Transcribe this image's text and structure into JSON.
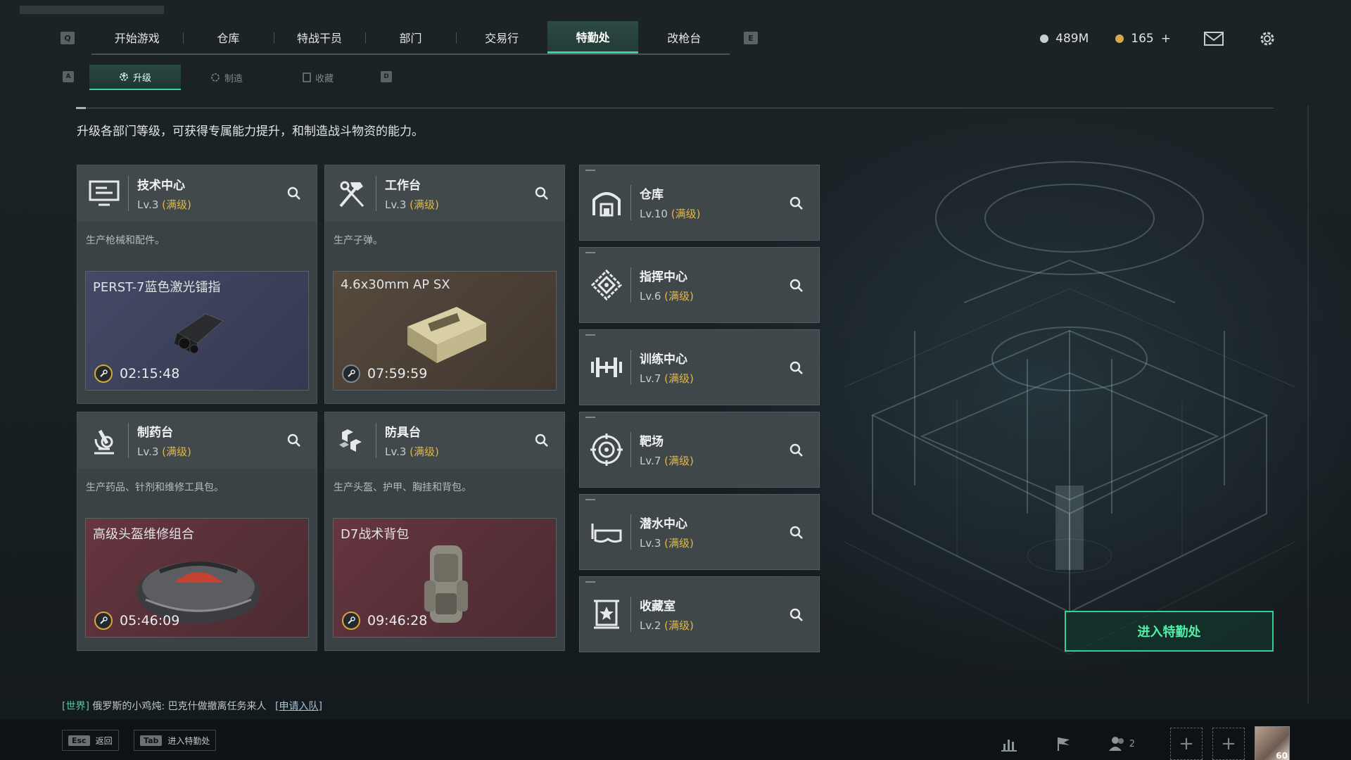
{
  "nav": {
    "left_key": "Q",
    "right_key": "E",
    "tabs": [
      {
        "label": "开始游戏"
      },
      {
        "label": "仓库"
      },
      {
        "label": "特战干员"
      },
      {
        "label": "部门"
      },
      {
        "label": "交易行"
      },
      {
        "label": "特勤处"
      },
      {
        "label": "改枪台"
      }
    ],
    "active_tab": "特勤处"
  },
  "currency": {
    "silver": "489M",
    "gold": "165",
    "gold_add": "+"
  },
  "subnav": {
    "left_key": "A",
    "right_key": "D",
    "tabs": [
      {
        "label": "升级"
      },
      {
        "label": "制造"
      },
      {
        "label": "收藏"
      }
    ],
    "active_tab": "升级"
  },
  "description": "升级各部门等级，可获得专属能力提升，和制造战斗物资的能力。",
  "production_cards": [
    {
      "name": "技术中心",
      "level": "Lv.3",
      "status": "(满级)",
      "icon": "monitor-icon",
      "desc": "生产枪械和配件。",
      "product": {
        "name": "PERST-7蓝色激光镭指",
        "timer": "02:15:48",
        "bg": "#3b3f58"
      }
    },
    {
      "name": "工作台",
      "level": "Lv.3",
      "status": "(满级)",
      "icon": "hammer-wrench-icon",
      "desc": "生产子弹。",
      "product": {
        "name": "4.6x30mm AP SX",
        "timer": "07:59:59",
        "bg": "#4a423a"
      }
    },
    {
      "name": "制药台",
      "level": "Lv.3",
      "status": "(满级)",
      "icon": "microscope-icon",
      "desc": "生产药品、针剂和维修工具包。",
      "product": {
        "name": "高级头盔维修组合",
        "timer": "05:46:09",
        "bg": "#5a3038"
      }
    },
    {
      "name": "防具台",
      "level": "Lv.3",
      "status": "(满级)",
      "icon": "armor-boxes-icon",
      "desc": "生产头盔、护甲、胸挂和背包。",
      "product": {
        "name": "D7战术背包",
        "timer": "09:46:28",
        "bg": "#5a3038"
      }
    }
  ],
  "department_cards": [
    {
      "name": "仓库",
      "level": "Lv.10",
      "status": "(满级)",
      "icon": "warehouse-icon"
    },
    {
      "name": "指挥中心",
      "level": "Lv.6",
      "status": "(满级)",
      "icon": "command-emblem-icon"
    },
    {
      "name": "训练中心",
      "level": "Lv.7",
      "status": "(满级)",
      "icon": "dumbbell-icon"
    },
    {
      "name": "靶场",
      "level": "Lv.7",
      "status": "(满级)",
      "icon": "target-icon"
    },
    {
      "name": "潜水中心",
      "level": "Lv.3",
      "status": "(满级)",
      "icon": "diving-mask-icon"
    },
    {
      "name": "收藏室",
      "level": "Lv.2",
      "status": "(满级)",
      "icon": "trophy-case-icon"
    }
  ],
  "enter_button": "进入特勤处",
  "chat": {
    "channel": "[世界]",
    "sender": "俄罗斯的小鸡炖:",
    "message": "巴克什做撤离任务来人",
    "action": "[申请入队]"
  },
  "hints": [
    {
      "key": "Esc",
      "label": "返回"
    },
    {
      "key": "Tab",
      "label": "进入特勤处"
    }
  ],
  "bottom_right": {
    "friends_count": "2",
    "avatar_level": "60"
  },
  "colors": {
    "accent_green": "#35d49a",
    "maxed_gold": "#e2b843"
  }
}
